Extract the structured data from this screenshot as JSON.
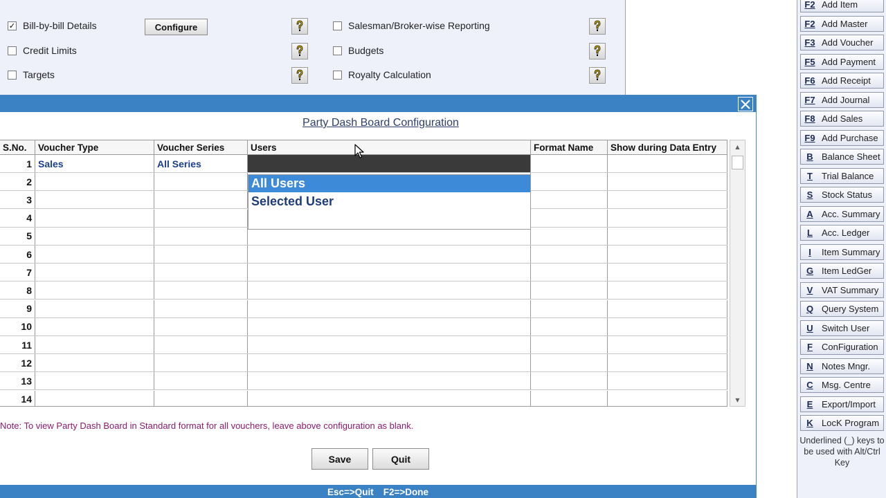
{
  "options_panel": {
    "left_options": [
      {
        "label": "Bill-by-bill Details",
        "checked": true
      },
      {
        "label": "Credit Limits",
        "checked": false
      },
      {
        "label": "Targets",
        "checked": false
      }
    ],
    "right_options": [
      {
        "label": "Salesman/Broker-wise Reporting",
        "checked": false
      },
      {
        "label": "Budgets",
        "checked": false
      },
      {
        "label": "Royalty Calculation",
        "checked": false
      }
    ],
    "configure_label": "Configure",
    "check_mark": "✓"
  },
  "sidebar": {
    "items": [
      {
        "key": "F2",
        "label": "Add Item"
      },
      {
        "key": "F2",
        "label": "Add Master"
      },
      {
        "key": "F3",
        "label": "Add Voucher"
      },
      {
        "key": "F5",
        "label": "Add Payment"
      },
      {
        "key": "F6",
        "label": "Add Receipt"
      },
      {
        "key": "F7",
        "label": "Add Journal"
      },
      {
        "key": "F8",
        "label": "Add Sales"
      },
      {
        "key": "F9",
        "label": "Add Purchase"
      },
      {
        "key": "B",
        "label": "Balance Sheet"
      },
      {
        "key": "T",
        "label": "Trial Balance"
      },
      {
        "key": "S",
        "label": "Stock Status"
      },
      {
        "key": "A",
        "label": "Acc. Summary"
      },
      {
        "key": "L",
        "label": "Acc. Ledger"
      },
      {
        "key": "I",
        "label": "Item Summary"
      },
      {
        "key": "G",
        "label": "Item LedGer"
      },
      {
        "key": "V",
        "label": "VAT Summary"
      },
      {
        "key": "Q",
        "label": "Query System"
      },
      {
        "key": "U",
        "label": "Switch User"
      },
      {
        "key": "F",
        "label": "ConFiguration"
      },
      {
        "key": "N",
        "label": "Notes Mngr."
      },
      {
        "key": "C",
        "label": "Msg. Centre"
      },
      {
        "key": "E",
        "label": "Export/Import"
      },
      {
        "key": "K",
        "label": "LocK Program"
      }
    ],
    "note": "Underlined (_) keys to be used with Alt/Ctrl Key"
  },
  "dialog": {
    "close_glyph": "✕",
    "title": "Party Dash Board Configuration",
    "columns": [
      "S.No.",
      "Voucher Type",
      "Voucher Series",
      "Users",
      "Format Name",
      "Show during Data Entry"
    ],
    "rows": [
      {
        "sno": "1",
        "voucher_type": "Sales",
        "voucher_series": "All Series",
        "users": "",
        "format_name": "",
        "show": ""
      },
      {
        "sno": "2",
        "voucher_type": "",
        "voucher_series": "",
        "users": "",
        "format_name": "",
        "show": ""
      },
      {
        "sno": "3",
        "voucher_type": "",
        "voucher_series": "",
        "users": "",
        "format_name": "",
        "show": ""
      },
      {
        "sno": "4",
        "voucher_type": "",
        "voucher_series": "",
        "users": "",
        "format_name": "",
        "show": ""
      },
      {
        "sno": "5",
        "voucher_type": "",
        "voucher_series": "",
        "users": "",
        "format_name": "",
        "show": ""
      },
      {
        "sno": "6",
        "voucher_type": "",
        "voucher_series": "",
        "users": "",
        "format_name": "",
        "show": ""
      },
      {
        "sno": "7",
        "voucher_type": "",
        "voucher_series": "",
        "users": "",
        "format_name": "",
        "show": ""
      },
      {
        "sno": "8",
        "voucher_type": "",
        "voucher_series": "",
        "users": "",
        "format_name": "",
        "show": ""
      },
      {
        "sno": "9",
        "voucher_type": "",
        "voucher_series": "",
        "users": "",
        "format_name": "",
        "show": ""
      },
      {
        "sno": "10",
        "voucher_type": "",
        "voucher_series": "",
        "users": "",
        "format_name": "",
        "show": ""
      },
      {
        "sno": "11",
        "voucher_type": "",
        "voucher_series": "",
        "users": "",
        "format_name": "",
        "show": ""
      },
      {
        "sno": "12",
        "voucher_type": "",
        "voucher_series": "",
        "users": "",
        "format_name": "",
        "show": ""
      },
      {
        "sno": "13",
        "voucher_type": "",
        "voucher_series": "",
        "users": "",
        "format_name": "",
        "show": ""
      },
      {
        "sno": "14",
        "voucher_type": "",
        "voucher_series": "",
        "users": "",
        "format_name": "",
        "show": ""
      }
    ],
    "users_dropdown": {
      "options": [
        "All Users",
        "Selected User"
      ],
      "selected": "All Users"
    },
    "scroll_up_glyph": "▲",
    "scroll_down_glyph": "▼",
    "note": "Note: To view Party Dash Board in Standard format for all vouchers, leave above configuration as blank.",
    "save_label": "Save",
    "quit_label": "Quit",
    "status": {
      "quit_hint": "Esc=>Quit",
      "done_hint": "F2=>Done"
    }
  }
}
